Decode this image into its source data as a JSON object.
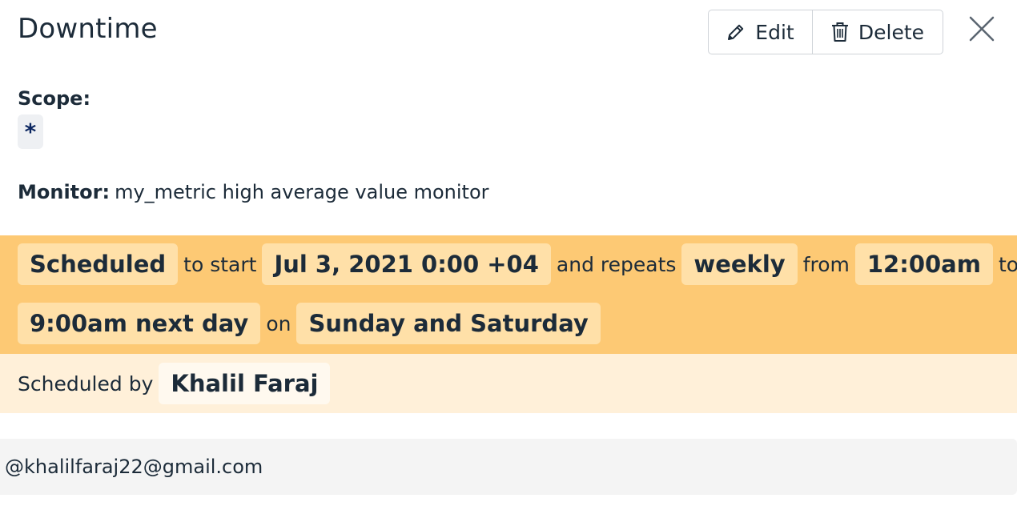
{
  "header": {
    "title": "Downtime",
    "edit_label": "Edit",
    "edit_icon": "pencil-icon",
    "delete_label": "Delete",
    "delete_icon": "trash-icon",
    "close_icon": "close-icon"
  },
  "scope": {
    "label": "Scope:",
    "value": "*"
  },
  "monitor": {
    "label": "Monitor:",
    "value": "my_metric high average value monitor"
  },
  "schedule": {
    "status": "Scheduled",
    "to_start": "to start",
    "start": "Jul 3, 2021 0:00 +04",
    "and_repeats": "and repeats",
    "frequency": "weekly",
    "from": "from",
    "from_time": "12:00am",
    "to": "to",
    "to_time": "9:00am next day",
    "on": "on",
    "days": "Sunday and Saturday"
  },
  "scheduled_by": {
    "label": "Scheduled by",
    "name": "Khalil Faraj"
  },
  "message": "@khalilfaraj22@gmail.com",
  "colors": {
    "schedule_band": "#fdc974",
    "schedule_chip": "#ffe0a8",
    "byline_band": "#fff0d9",
    "text": "#1c2b39"
  }
}
